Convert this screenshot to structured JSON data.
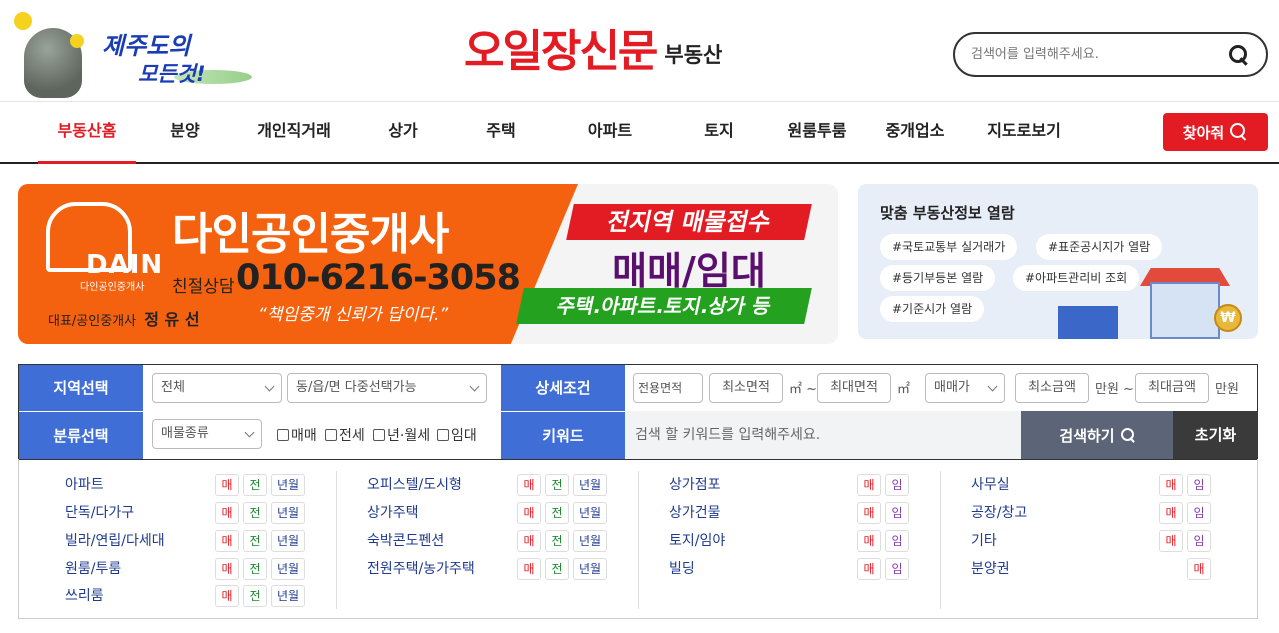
{
  "header": {
    "jeju_line1": "제주도의",
    "jeju_line2": "모든것!",
    "brand_name": "오일장신문",
    "brand_sub": "부동산",
    "search_placeholder": "검색어를 입력해주세요."
  },
  "nav": {
    "items": [
      "부동산홈",
      "분양",
      "개인직거래",
      "상가",
      "주택",
      "아파트",
      "토지",
      "원룸투룸",
      "중개업소",
      "지도로보기"
    ],
    "find_label": "찾아줘"
  },
  "banner": {
    "dain_logo": "DAIN",
    "dain_sub": "다인공인중개사",
    "agency_name": "다인공인중개사",
    "phone_label": "친절상담",
    "phone": "010-6216-3058",
    "rep_label": "대표/공인중개사",
    "rep_name": "정 유 선",
    "slogan": "“책임중개 신뢰가 답이다.”",
    "red_text": "전지역 매물접수",
    "purple_text": "매매/임대",
    "green_text": "주택.아파트.토지.상가 등"
  },
  "info_box": {
    "title": "맞춤 부동산정보 열람",
    "tags": [
      "#국토교통부 실거래가",
      "#표준공시지가 열람",
      "#등기부등본 열람",
      "#아파트관리비 조회",
      "#기준시가 열람"
    ],
    "coin_symbol": "₩"
  },
  "form": {
    "region_label": "지역선택",
    "region_select": "전체",
    "dong_select": "동/읍/면 다중선택가능",
    "detail_label": "상세조건",
    "area_select": "전용면적",
    "min_area": "최소면적",
    "area_unit": "㎡ ~",
    "max_area": "최대면적",
    "area_unit2": "㎡",
    "price_select": "매매가",
    "min_price": "최소금액",
    "price_unit": "만원 ~",
    "max_price": "최대금액",
    "price_unit2": "만원",
    "category_label": "분류선택",
    "category_select": "매물종류",
    "checks": [
      "매매",
      "전세",
      "년·월세",
      "임대"
    ],
    "keyword_label": "키워드",
    "keyword_placeholder": "검색 할 키워드를 입력해주세요.",
    "search_btn": "검색하기",
    "reset_btn": "초기화"
  },
  "categories": {
    "badge_labels": {
      "sale": "매",
      "jeon": "전",
      "rent": "년월",
      "im": "임"
    },
    "col1": [
      "아파트",
      "단독/다가구",
      "빌라/연립/다세대",
      "원룸/투룸",
      "쓰리룸"
    ],
    "col2": [
      "오피스텔/도시형",
      "상가주택",
      "숙박콘도펜션",
      "전원주택/농가주택"
    ],
    "col3": [
      "상가점포",
      "상가건물",
      "토지/임야",
      "빌딩"
    ],
    "col4": [
      "사무실",
      "공장/창고",
      "기타",
      "분양권"
    ]
  },
  "colors": {
    "brand_red": "#e31c24",
    "form_blue": "#3f6fd6",
    "banner_orange": "#f4620f",
    "banner_green": "#24a21f",
    "banner_purple": "#5a0f6e"
  }
}
